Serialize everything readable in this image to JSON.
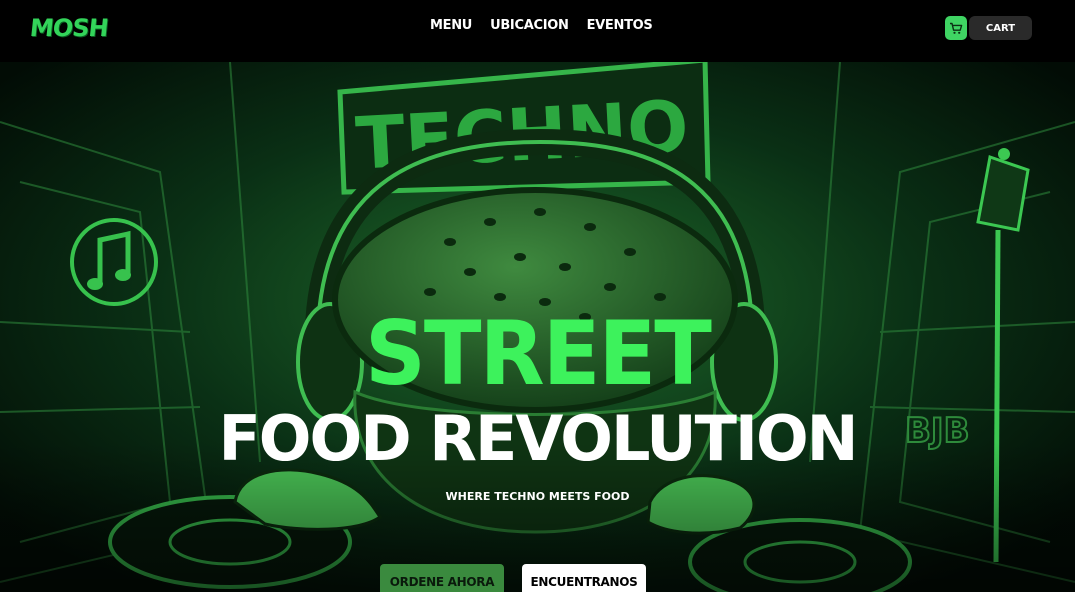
{
  "header": {
    "logo_text": "MOSH",
    "nav": [
      {
        "label": "MENU"
      },
      {
        "label": "UBICACION"
      },
      {
        "label": "EVENTOS"
      }
    ],
    "cart_label": "CART",
    "cart_icon": "cart-icon"
  },
  "hero": {
    "headline_line1": "STREET",
    "headline_line2": "FOOD REVOLUTION",
    "tagline": "WHERE TECHNO MEETS FOOD",
    "sign_text": "TECHNO",
    "graffiti_text": "BJB",
    "music_icon": "music-note-icon",
    "primary_cta": "ORDENE AHORA",
    "secondary_cta": "ENCUENTRANOS"
  },
  "colors": {
    "accent": "#3df25c",
    "background": "#000000",
    "cart_icon_bg": "#3fd463",
    "cart_button_bg": "#2a2a2a",
    "primary_cta_bg": "#3a8a3e"
  }
}
